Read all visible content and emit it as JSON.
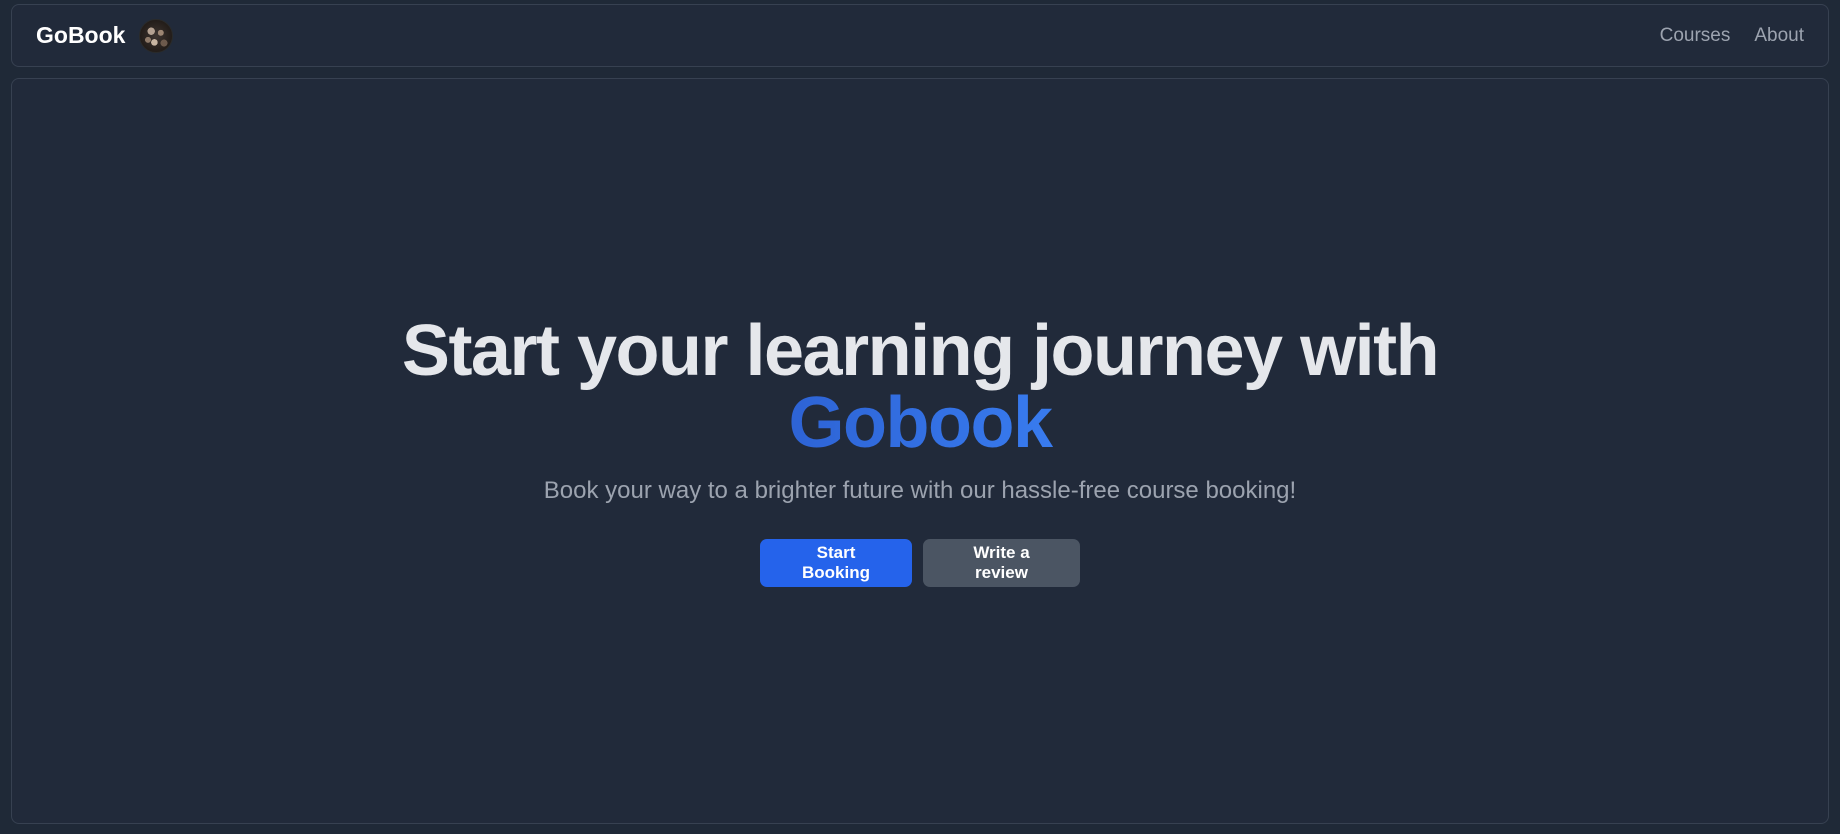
{
  "navbar": {
    "brand": "GoBook",
    "avatar_icon": "brand-avatar-icon",
    "links": [
      "Courses",
      "About"
    ]
  },
  "hero": {
    "title_line1": "Start your learning journey with",
    "title_highlight": "Gobook",
    "subtitle": "Book your way to a brighter future with our hassle-free course booking!",
    "primary_button": "Start Booking",
    "secondary_button": "Write a review"
  },
  "colors": {
    "background": "#1f2937",
    "primary": "#2563eb",
    "secondary": "#4b5563",
    "highlight_start": "#1e40af",
    "highlight_end": "#60a5fa"
  }
}
